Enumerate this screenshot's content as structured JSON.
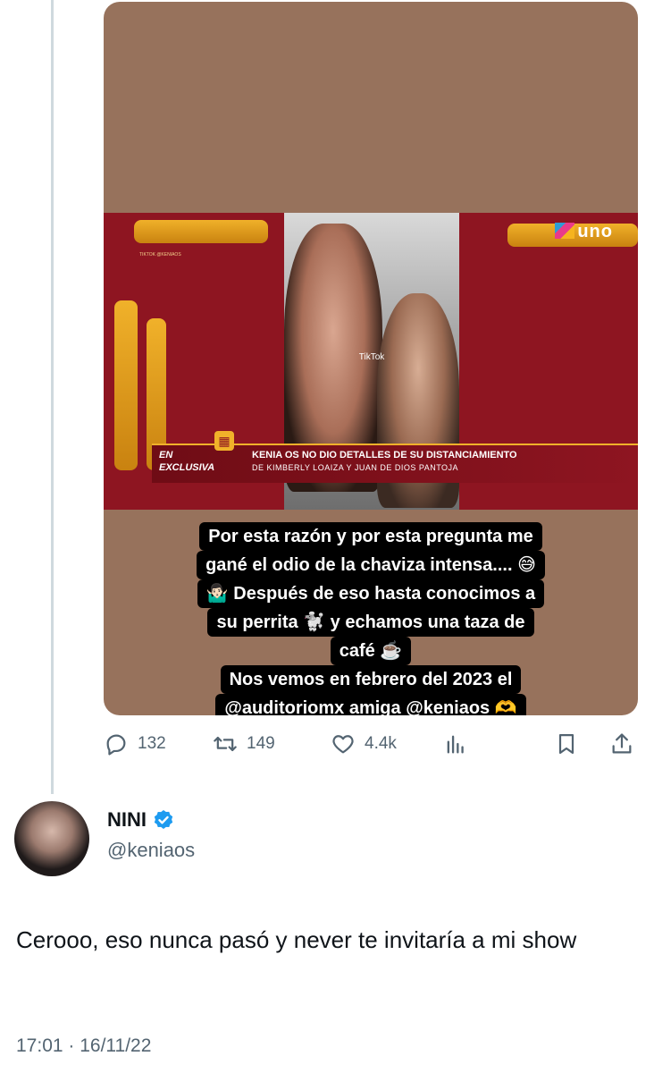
{
  "media": {
    "tv_logo": "uno",
    "tiktok_label": "TikTok",
    "tiktok_tag": "TIKTOK @KENIAOS",
    "badge_en": "EN",
    "badge_exclusiva": "EXCLUSIVA",
    "headline": "KENIA OS NO DIO DETALLES DE SU DISTANCIAMIENTO",
    "subheadline": "DE KIMBERLY LOAIZA Y JUAN DE DIOS PANTOJA",
    "caption_lines": [
      "Por esta razón y por esta pregunta me",
      "gané el odio de la chaviza intensa.... 😅",
      "🤷🏻‍♂️ Después de eso hasta conocimos a",
      "su perrita 🐩 y echamos una taza de",
      "café ☕️",
      "Nos vemos en febrero del 2023 el",
      "@auditoriomx amiga @keniaos 🫶"
    ]
  },
  "actions": {
    "replies": "132",
    "retweets": "149",
    "likes": "4.4k"
  },
  "reply": {
    "display_name": "NINI",
    "handle": "@keniaos",
    "text": "Cerooo, eso nunca pasó y never te invitaría a mi show",
    "timestamp": "17:01 · 16/11/22"
  },
  "colors": {
    "accent_verified": "#1d9bf0",
    "muted_text": "#536471",
    "thread_line": "#cfd9de"
  }
}
